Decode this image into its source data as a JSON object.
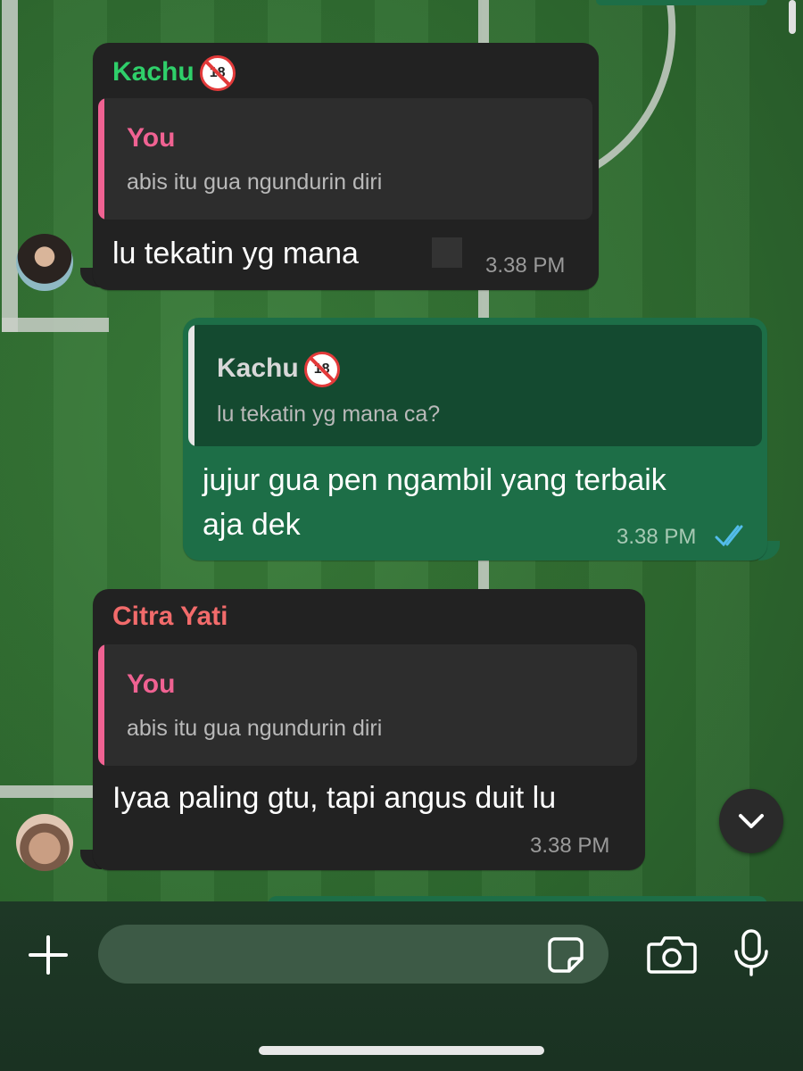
{
  "chat": {
    "messages": [
      {
        "direction": "incoming",
        "sender": "Kachu",
        "sender_color": "#2fcf6a",
        "reply": {
          "name": "You",
          "name_color": "#f06292",
          "text": "abis itu gua ngundurin diri"
        },
        "text": "lu tekatin yg mana",
        "time": "3.38 PM"
      },
      {
        "direction": "outgoing",
        "reply": {
          "name": "Kachu",
          "name_color": "#d8d8d8",
          "text": "lu tekatin yg mana ca?"
        },
        "text_lines": [
          "jujur gua pen ngambil yang terbaik",
          "aja dek"
        ],
        "time": "3.38 PM",
        "status": "read"
      },
      {
        "direction": "incoming",
        "sender": "Citra Yati",
        "sender_color": "#f26b6b",
        "reply": {
          "name": "You",
          "name_color": "#f06292",
          "text": "abis itu gua ngundurin diri"
        },
        "text": "Iyaa paling gtu, tapi angus duit lu",
        "time": "3.38 PM"
      }
    ]
  },
  "composer": {
    "add_icon": "plus-icon",
    "sticker_icon": "sticker-icon",
    "camera_icon": "camera-icon",
    "mic_icon": "microphone-icon"
  },
  "scroll_button": {
    "icon": "chevron-down-icon"
  },
  "colors": {
    "incoming_bubble": "#222222",
    "outgoing_bubble": "#1d6e47",
    "read_ticks": "#53bdeb"
  }
}
